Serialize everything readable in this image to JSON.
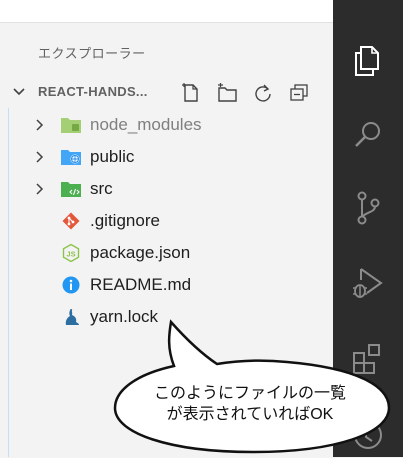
{
  "explorer": {
    "title": "エクスプローラー",
    "project_name": "REACT-HANDS..."
  },
  "tree": [
    {
      "label": "node_modules",
      "kind": "folder",
      "icon": "folder-node-icon",
      "dim": true
    },
    {
      "label": "public",
      "kind": "folder",
      "icon": "folder-public-icon",
      "dim": false
    },
    {
      "label": "src",
      "kind": "folder",
      "icon": "folder-src-icon",
      "dim": false
    },
    {
      "label": ".gitignore",
      "kind": "file",
      "icon": "git-icon",
      "dim": false
    },
    {
      "label": "package.json",
      "kind": "file",
      "icon": "nodejs-icon",
      "dim": false
    },
    {
      "label": "README.md",
      "kind": "file",
      "icon": "info-icon",
      "dim": false
    },
    {
      "label": "yarn.lock",
      "kind": "file",
      "icon": "yarn-icon",
      "dim": false
    }
  ],
  "bubble": {
    "line1": "このようにファイルの一覧",
    "line2": "が表示されていればOK"
  },
  "colors": {
    "sidebar_bg": "#f3f3f3",
    "activity_bar_bg": "#2c2c2c",
    "tree_border": "#c7ddf3",
    "folder_green": "#8bc34a",
    "folder_blue": "#42a5f5",
    "git_red": "#e4573a",
    "info_blue": "#2196f3",
    "yarn_blue": "#2c6ea0"
  }
}
